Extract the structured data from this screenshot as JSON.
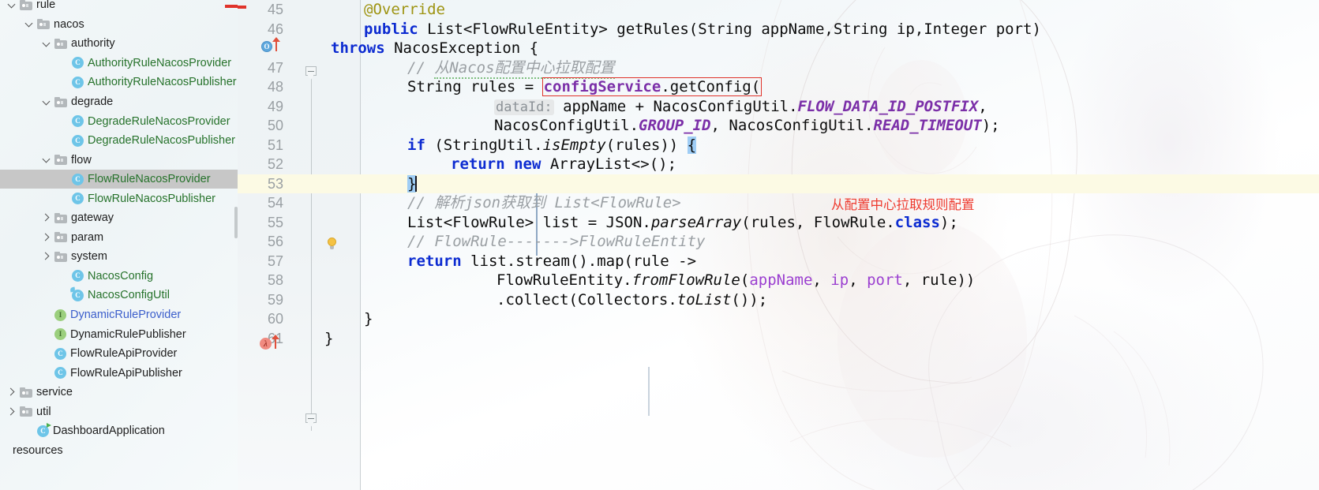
{
  "sidebar": {
    "scroll_visible": true,
    "items": [
      {
        "label": "rule",
        "indent": 0,
        "toggle": "down",
        "icon": "folder-icon",
        "color": "dark",
        "selected": false
      },
      {
        "label": "nacos",
        "indent": 1,
        "toggle": "down",
        "icon": "folder-icon",
        "color": "dark",
        "selected": false
      },
      {
        "label": "authority",
        "indent": 2,
        "toggle": "down",
        "icon": "folder-icon",
        "color": "dark",
        "selected": false
      },
      {
        "label": "AuthorityRuleNacosProvider",
        "indent": 3,
        "toggle": "none",
        "icon": "java-class-icon",
        "color": "green",
        "selected": false
      },
      {
        "label": "AuthorityRuleNacosPublisher",
        "indent": 3,
        "toggle": "none",
        "icon": "java-class-icon",
        "color": "green",
        "selected": false
      },
      {
        "label": "degrade",
        "indent": 2,
        "toggle": "down",
        "icon": "folder-icon",
        "color": "dark",
        "selected": false
      },
      {
        "label": "DegradeRuleNacosProvider",
        "indent": 3,
        "toggle": "none",
        "icon": "java-class-icon",
        "color": "green",
        "selected": false
      },
      {
        "label": "DegradeRuleNacosPublisher",
        "indent": 3,
        "toggle": "none",
        "icon": "java-class-icon",
        "color": "green",
        "selected": false
      },
      {
        "label": "flow",
        "indent": 2,
        "toggle": "down",
        "icon": "folder-icon",
        "color": "dark",
        "selected": false
      },
      {
        "label": "FlowRuleNacosProvider",
        "indent": 3,
        "toggle": "none",
        "icon": "java-class-icon",
        "color": "green",
        "selected": true
      },
      {
        "label": "FlowRuleNacosPublisher",
        "indent": 3,
        "toggle": "none",
        "icon": "java-class-icon",
        "color": "green",
        "selected": false
      },
      {
        "label": "gateway",
        "indent": 2,
        "toggle": "right",
        "icon": "folder-icon",
        "color": "dark",
        "selected": false
      },
      {
        "label": "param",
        "indent": 2,
        "toggle": "right",
        "icon": "folder-icon",
        "color": "dark",
        "selected": false
      },
      {
        "label": "system",
        "indent": 2,
        "toggle": "right",
        "icon": "folder-icon",
        "color": "dark",
        "selected": false
      },
      {
        "label": "NacosConfig",
        "indent": 3,
        "toggle": "none",
        "icon": "java-class-icon",
        "color": "green",
        "selected": false
      },
      {
        "label": "NacosConfigUtil",
        "indent": 3,
        "toggle": "none",
        "icon": "java-class-util-icon",
        "color": "green",
        "selected": false
      },
      {
        "label": "DynamicRuleProvider",
        "indent": 2,
        "toggle": "none",
        "icon": "java-interface-icon",
        "color": "blue",
        "selected": false
      },
      {
        "label": "DynamicRulePublisher",
        "indent": 2,
        "toggle": "none",
        "icon": "java-interface-icon",
        "color": "dark",
        "selected": false
      },
      {
        "label": "FlowRuleApiProvider",
        "indent": 2,
        "toggle": "none",
        "icon": "java-class-icon",
        "color": "dark",
        "selected": false
      },
      {
        "label": "FlowRuleApiPublisher",
        "indent": 2,
        "toggle": "none",
        "icon": "java-class-icon",
        "color": "dark",
        "selected": false
      },
      {
        "label": "service",
        "indent": 0,
        "toggle": "right",
        "icon": "folder-icon",
        "color": "dark",
        "selected": false
      },
      {
        "label": "util",
        "indent": 0,
        "toggle": "right",
        "icon": "folder-icon",
        "color": "dark",
        "selected": false
      },
      {
        "label": "DashboardApplication",
        "indent": 1,
        "toggle": "none",
        "icon": "java-runnable-class-icon",
        "color": "dark",
        "selected": false
      },
      {
        "label": "resources",
        "indent": -1,
        "toggle": "none",
        "icon": "none",
        "color": "dark",
        "selected": false
      }
    ]
  },
  "editor": {
    "language": "java",
    "annotation_red": "从配置中心拉取规则配置",
    "current_line": 53,
    "first_visible_line": 44,
    "lines": [
      {
        "number": 45,
        "gutter": []
      },
      {
        "number": 46,
        "gutter": [
          "overriding-method-icon",
          "up-arrow-icon"
        ]
      },
      {
        "number": 47,
        "gutter": [
          "fold-marker-icon"
        ]
      },
      {
        "number": 48,
        "gutter": []
      },
      {
        "number": 49,
        "gutter": []
      },
      {
        "number": 50,
        "gutter": []
      },
      {
        "number": 51,
        "gutter": []
      },
      {
        "number": 52,
        "gutter": []
      },
      {
        "number": 53,
        "gutter": [
          "intention-bulb-icon"
        ]
      },
      {
        "number": 54,
        "gutter": []
      },
      {
        "number": 55,
        "gutter": []
      },
      {
        "number": 56,
        "gutter": []
      },
      {
        "number": 57,
        "gutter": [
          "lambda-icon",
          "up-arrow-icon"
        ]
      },
      {
        "number": 58,
        "gutter": []
      },
      {
        "number": 59,
        "gutter": []
      },
      {
        "number": 60,
        "gutter": [
          "fold-marker-icon"
        ]
      },
      {
        "number": 61,
        "gutter": []
      }
    ],
    "code_text": {
      "l45": "@Override",
      "l46": "public List<FlowRuleEntity> getRules(String appName,String ip,Integer port)",
      "l46b": "throws NacosException {",
      "l47": "// 从Nacos配置中心拉取配置",
      "l48": "String rules = configService.getConfig(",
      "l49_hint": "dataId:",
      "l49": "appName + NacosConfigUtil.FLOW_DATA_ID_POSTFIX,",
      "l50": "NacosConfigUtil.GROUP_ID, NacosConfigUtil.READ_TIMEOUT);",
      "l51": "if (StringUtil.isEmpty(rules)) {",
      "l52": "return new ArrayList<>();",
      "l53": "}",
      "l54": "// 解析json获取到 List<FlowRule>",
      "l55": "List<FlowRule> list = JSON.parseArray(rules, FlowRule.class);",
      "l56": "// FlowRule------->FlowRuleEntity",
      "l57": "return list.stream().map(rule ->",
      "l58": "FlowRuleEntity.fromFlowRule(appName, ip, port, rule))",
      "l59": ".collect(Collectors.toList());",
      "l60": "}",
      "l61": "}"
    }
  },
  "colors": {
    "keyword": "#0c2bd1",
    "annotation": "#9e9412",
    "comment": "#9a9fa3",
    "static_field": "#7b2fa8",
    "parameter": "#9b3fd0",
    "red_note": "#ee3b30",
    "selection": "#c7c7c7",
    "current_line": "#fcfae4",
    "class_green": "#26722b",
    "interface_blue": "#3b5ecb"
  }
}
